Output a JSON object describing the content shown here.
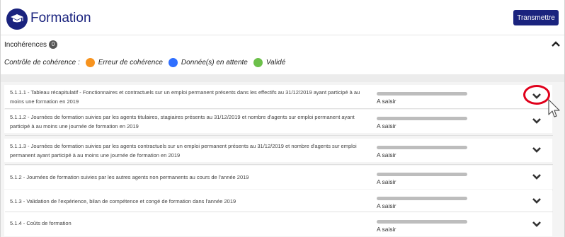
{
  "header": {
    "title": "Formation",
    "icon": "graduation-cap-icon",
    "transmit_label": "Transmettre"
  },
  "incoherences": {
    "label": "Incohérences",
    "count": "0",
    "toggle_icon": "chevron-up-icon"
  },
  "coherence": {
    "label": "Contrôle de cohérence :",
    "legend": [
      {
        "label": "Erreur de cohérence",
        "color": "#f7931e"
      },
      {
        "label": "Donnée(s) en attente",
        "color": "#2f6fff"
      },
      {
        "label": "Validé",
        "color": "#6cc04a"
      }
    ]
  },
  "rows": [
    {
      "label": "5.1.1.1 - Tableau récapitulatif - Fonctionnaires et contractuels sur un emploi permanent présents dans les effectifs au 31/12/2019 ayant participé à au moins une formation en 2019",
      "status": "A saisir"
    },
    {
      "label": "5.1.1.2 - Journées de formation suivies par les agents titulaires, stagiaires présents au 31/12/2019 et nombre d'agents sur emploi permanent ayant participé à au moins une journée de formation en 2019",
      "status": "A saisir"
    },
    {
      "label": "5.1.1.3 - Journées de formation suivies par les agents contractuels sur un emploi permanent présents au 31/12/2019 et nombre d'agents sur emploi permanent ayant participé à au moins une journée de formation en 2019",
      "status": "A saisir"
    },
    {
      "label": "5.1.2 - Journées de formation suivies par les autres agents non permanents au cours de l'année 2019",
      "status": "A saisir"
    },
    {
      "label": "5.1.3 - Validation de l'expérience, bilan de compétence et congé de formation dans l'année 2019",
      "status": "A saisir"
    },
    {
      "label": "5.1.4 - Coûts de formation",
      "status": "A saisir"
    }
  ],
  "colors": {
    "brand": "#1a237e",
    "highlight": "#e0001b"
  }
}
